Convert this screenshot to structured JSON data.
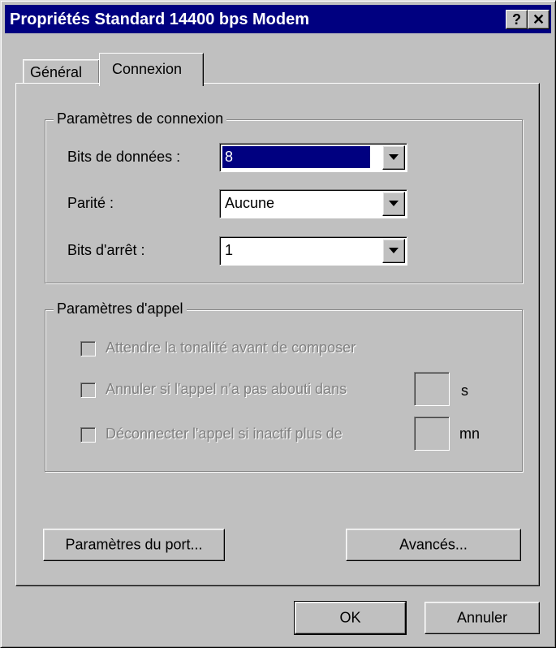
{
  "window": {
    "title": "Propriétés Standard 14400 bps Modem",
    "help_label": "?",
    "close_label": "✕"
  },
  "tabs": [
    {
      "label": "Général",
      "active": false
    },
    {
      "label": "Connexion",
      "active": true
    }
  ],
  "connection_group": {
    "title": "Paramètres de connexion",
    "data_bits": {
      "label": "Bits de données :",
      "value": "8"
    },
    "parity": {
      "label": "Parité :",
      "value": "Aucune"
    },
    "stop_bits": {
      "label": "Bits d'arrêt :",
      "value": "1"
    }
  },
  "call_group": {
    "title": "Paramètres d'appel",
    "wait_tone": {
      "label": "Attendre la tonalité avant de composer",
      "checked": false
    },
    "cancel_call": {
      "label": "Annuler si l'appel n'a pas abouti dans",
      "value": "",
      "unit": "s",
      "checked": false
    },
    "disconnect": {
      "label": "Déconnecter l'appel si inactif plus de",
      "value": "",
      "unit": "mn",
      "checked": false
    }
  },
  "buttons": {
    "port_settings": "Paramètres du port...",
    "advanced": "Avancés...",
    "ok": "OK",
    "cancel": "Annuler"
  },
  "icons": {
    "dropdown": "chevron-down-icon"
  }
}
